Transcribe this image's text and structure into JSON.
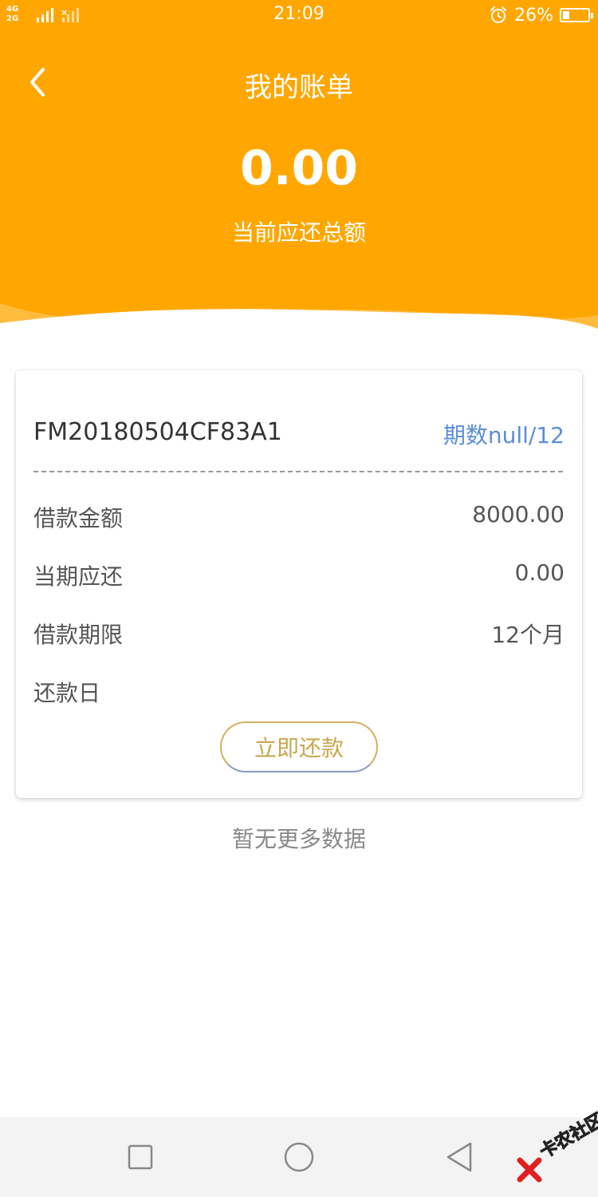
{
  "status_bar": {
    "network_top": "4G",
    "network_bottom": "2G",
    "time": "21:09",
    "battery_percent": "26%",
    "battery_level": 0.26
  },
  "header": {
    "title": "我的账单",
    "total_amount": "0.00",
    "total_label": "当前应还总额",
    "background_color": "#FFA700"
  },
  "bill": {
    "loan_id": "FM20180504CF83A1",
    "period": "期数null/12",
    "rows": [
      {
        "label": "借款金额",
        "value": "8000.00"
      },
      {
        "label": "当期应还",
        "value": "0.00"
      },
      {
        "label": "借款期限",
        "value": "12个月"
      },
      {
        "label": "还款日",
        "value": ""
      }
    ],
    "repay_button": "立即还款"
  },
  "footer_note": "暂无更多数据",
  "nav_bar": {
    "icons": [
      "recent-apps-icon",
      "home-icon",
      "back-icon"
    ]
  },
  "watermark": "卡农社区"
}
